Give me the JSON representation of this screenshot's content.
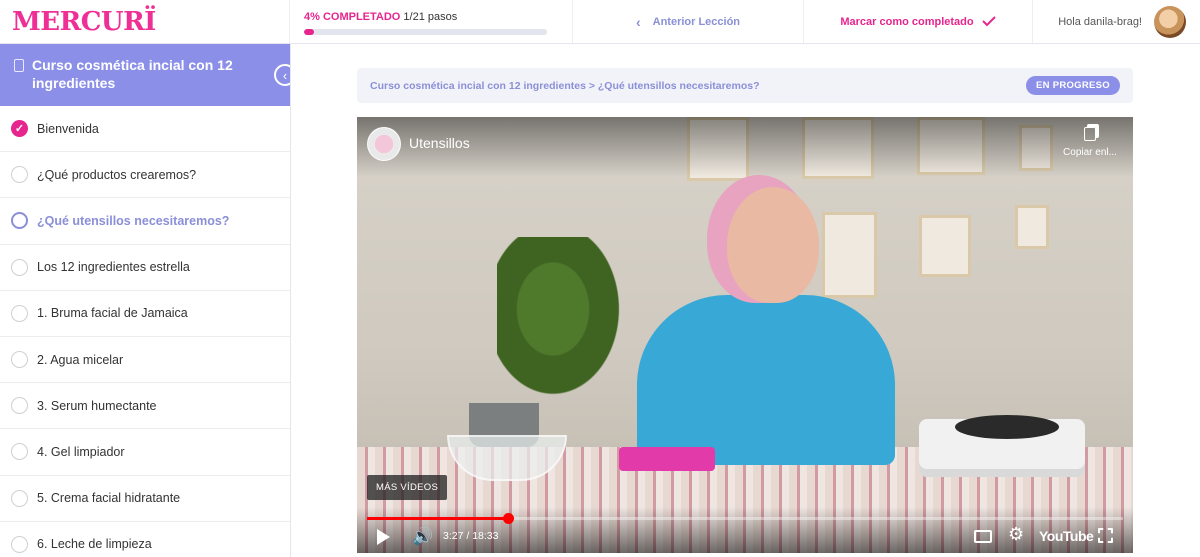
{
  "brand": {
    "logo_text": "MERCURÏ",
    "accent": "#e6258f",
    "secondary": "#8b8fe8"
  },
  "topbar": {
    "progress_percent_text": "4% COMPLETADO",
    "progress_steps_text": "1/21 pasos",
    "progress_fraction": 0.04,
    "prev_label": "Anterior Lección",
    "prev_icon": "chevron-left-icon",
    "mark_complete_label": "Marcar como completado",
    "mark_complete_icon": "check-icon",
    "greeting": "Hola danila-brag!"
  },
  "sidebar": {
    "course_title": "Curso cosmética incial con 12 ingredientes",
    "collapse_icon": "chevron-left-icon",
    "lessons": [
      {
        "label": "Bienvenida",
        "state": "done"
      },
      {
        "label": "¿Qué productos crearemos?",
        "state": "todo"
      },
      {
        "label": "¿Qué utensillos necesitaremos?",
        "state": "active"
      },
      {
        "label": "Los 12 ingredientes estrella",
        "state": "todo"
      },
      {
        "label": "1. Bruma facial de Jamaica",
        "state": "todo"
      },
      {
        "label": "2. Agua micelar",
        "state": "todo"
      },
      {
        "label": "3. Serum humectante",
        "state": "todo"
      },
      {
        "label": "4. Gel limpiador",
        "state": "todo"
      },
      {
        "label": "5. Crema facial hidratante",
        "state": "todo"
      },
      {
        "label": "6. Leche de limpieza",
        "state": "todo"
      }
    ]
  },
  "main": {
    "breadcrumb": "Curso cosmética incial con 12 ingredientes > ¿Qué utensillos necesitaremos?",
    "status_badge": "EN PROGRESO"
  },
  "video": {
    "title": "Utensillos",
    "copy_link_label": "Copiar enl...",
    "more_videos_label": "MÁS VÍDEOS",
    "time_text": "3:27 / 18:33",
    "progress_fraction": 0.186,
    "youtube_label": "YouTube",
    "icons": [
      "play-icon",
      "volume-icon",
      "subtitles-icon",
      "settings-icon",
      "fullscreen-icon",
      "copy-link-icon"
    ]
  }
}
